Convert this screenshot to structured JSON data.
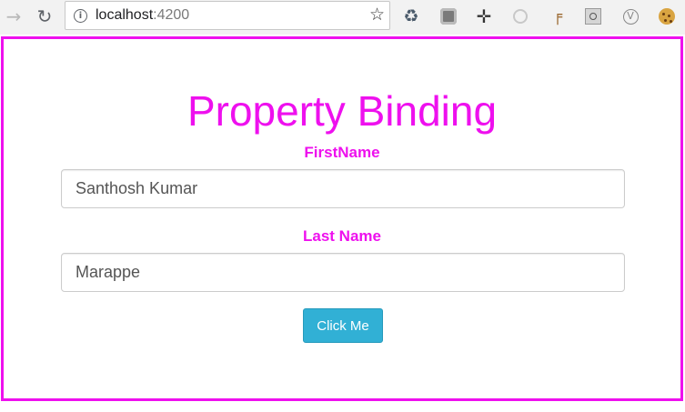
{
  "browser": {
    "url_host": "localhost",
    "url_port": ":4200",
    "icons": {
      "back": "back-arrow-icon",
      "reload": "reload-icon",
      "info": "info-icon",
      "bookmark": "star-icon"
    },
    "extensions": [
      "recycle-extension-icon",
      "gray-square-extension-icon",
      "move-cross-extension-icon",
      "circle-extension-icon",
      "pipe-extension-icon",
      "window-extension-icon",
      "v-circle-extension-icon",
      "cookie-extension-icon"
    ]
  },
  "app": {
    "accent_color": "#ee10ee",
    "title": "Property Binding",
    "first_name_label": "FirstName",
    "first_name_value": "Santhosh Kumar",
    "last_name_label": "Last Name",
    "last_name_value": "Marappe",
    "button_label": "Click Me",
    "button_color": "#31b0d5"
  }
}
